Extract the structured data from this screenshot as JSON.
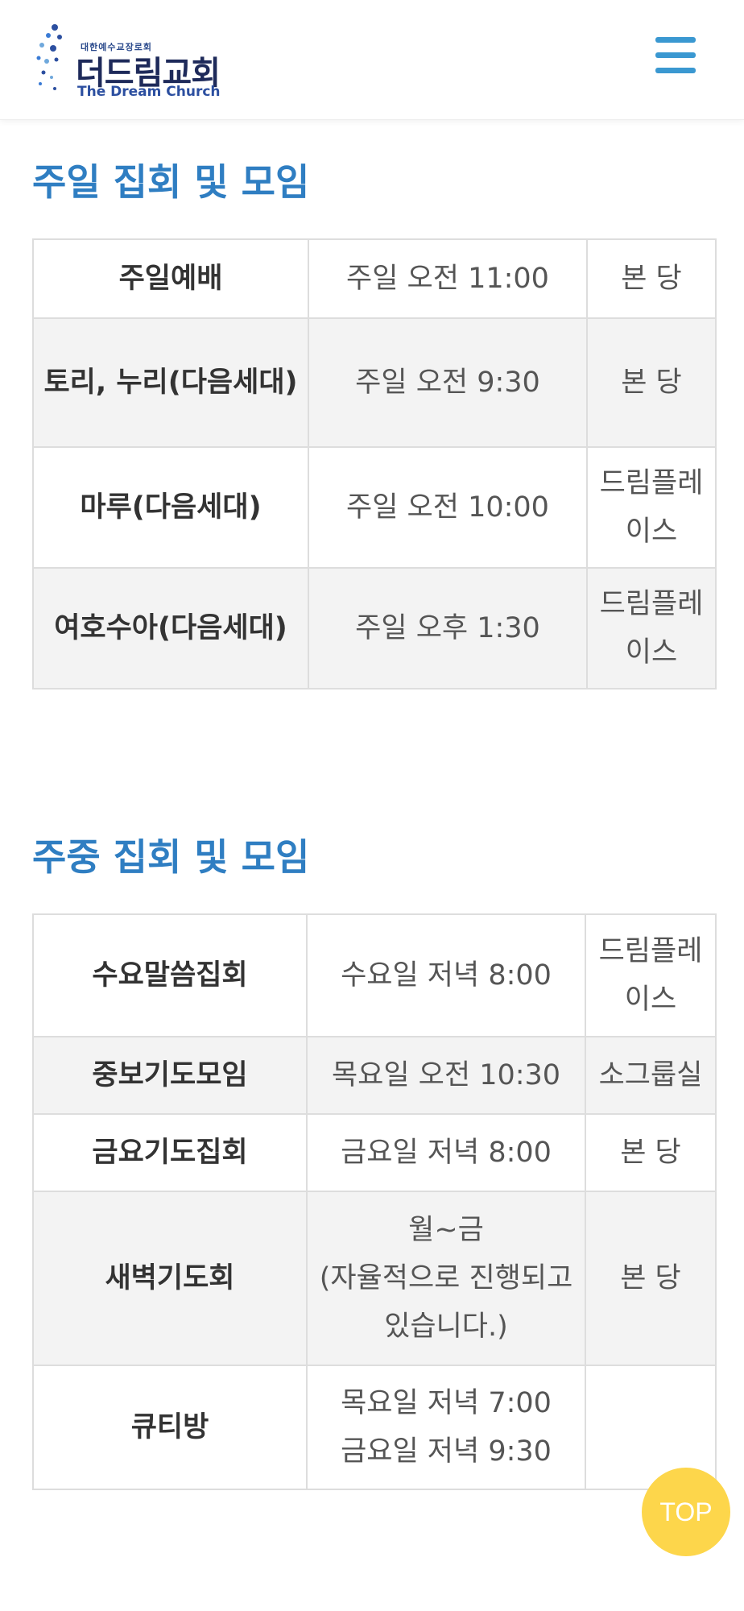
{
  "header": {
    "logo_small": "대한예수교장로회",
    "logo_main": "더드림교회",
    "logo_en": "The Dream Church",
    "menu_icon": "hamburger-menu-icon"
  },
  "sunday": {
    "title": "주일 집회 및 모임",
    "rows": [
      {
        "name": "주일예배",
        "time": "주일 오전 11:00",
        "place": "본 당"
      },
      {
        "name": "토리, 누리(다음세대)",
        "time": "주일 오전 9:30",
        "place": "본 당"
      },
      {
        "name": "마루(다음세대)",
        "time": "주일 오전 10:00",
        "place": "드림플레이스"
      },
      {
        "name": "여호수아(다음세대)",
        "time": "주일 오후 1:30",
        "place": "드림플레이스"
      }
    ]
  },
  "weekday": {
    "title": "주중 집회 및 모임",
    "rows": [
      {
        "name": "수요말씀집회",
        "time": "수요일 저녁 8:00",
        "place": "드림플레이스"
      },
      {
        "name": "중보기도모임",
        "time": "목요일 오전 10:30",
        "place": "소그룹실"
      },
      {
        "name": "금요기도집회",
        "time": "금요일 저녁 8:00",
        "place": "본 당"
      },
      {
        "name": "새벽기도회",
        "time_line1": "월~금",
        "time_line2": "(자율적으로 진행되고 있습니다.)",
        "place": "본 당"
      },
      {
        "name": "큐티방",
        "time_line1": "목요일 저녁 7:00",
        "time_line2": "금요일 저녁 9:30",
        "place": ""
      }
    ]
  },
  "top_button": {
    "label": "TOP"
  },
  "colors": {
    "accent": "#2f7ec2",
    "menu": "#3a98d1",
    "top_button": "#fdd64b",
    "row_alt": "#f3f3f3",
    "border": "#dddddd"
  }
}
